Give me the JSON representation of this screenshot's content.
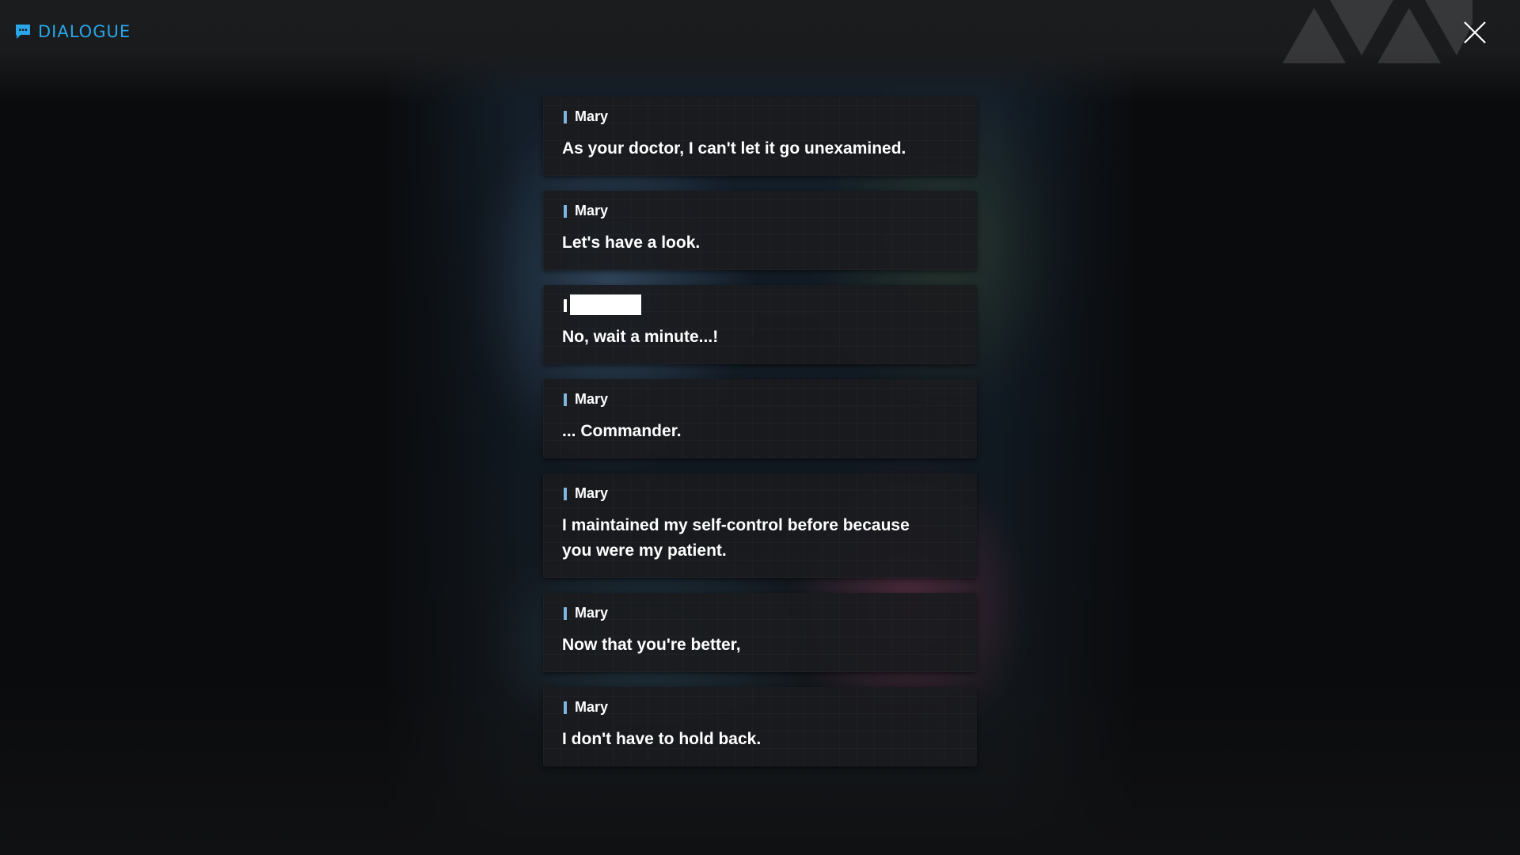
{
  "header": {
    "title": "DIALOGUE",
    "title_icon": "chat-bubble-icon",
    "close_icon": "close-icon",
    "accent_color": "#29a6e8"
  },
  "dialogue": [
    {
      "speaker": "Mary",
      "text": "As your doctor, I can't let it go unexamined."
    },
    {
      "speaker": "Mary",
      "text": "Let's have a look."
    },
    {
      "speaker": "",
      "speaker_redacted": true,
      "text": "No, wait a minute...!"
    },
    {
      "speaker": "Mary",
      "text": "... Commander."
    },
    {
      "speaker": "Mary",
      "text": "I maintained my self-control before because you were my patient."
    },
    {
      "speaker": "Mary",
      "text": "Now that you're better,"
    },
    {
      "speaker": "Mary",
      "text": "I don't have to hold back."
    }
  ]
}
